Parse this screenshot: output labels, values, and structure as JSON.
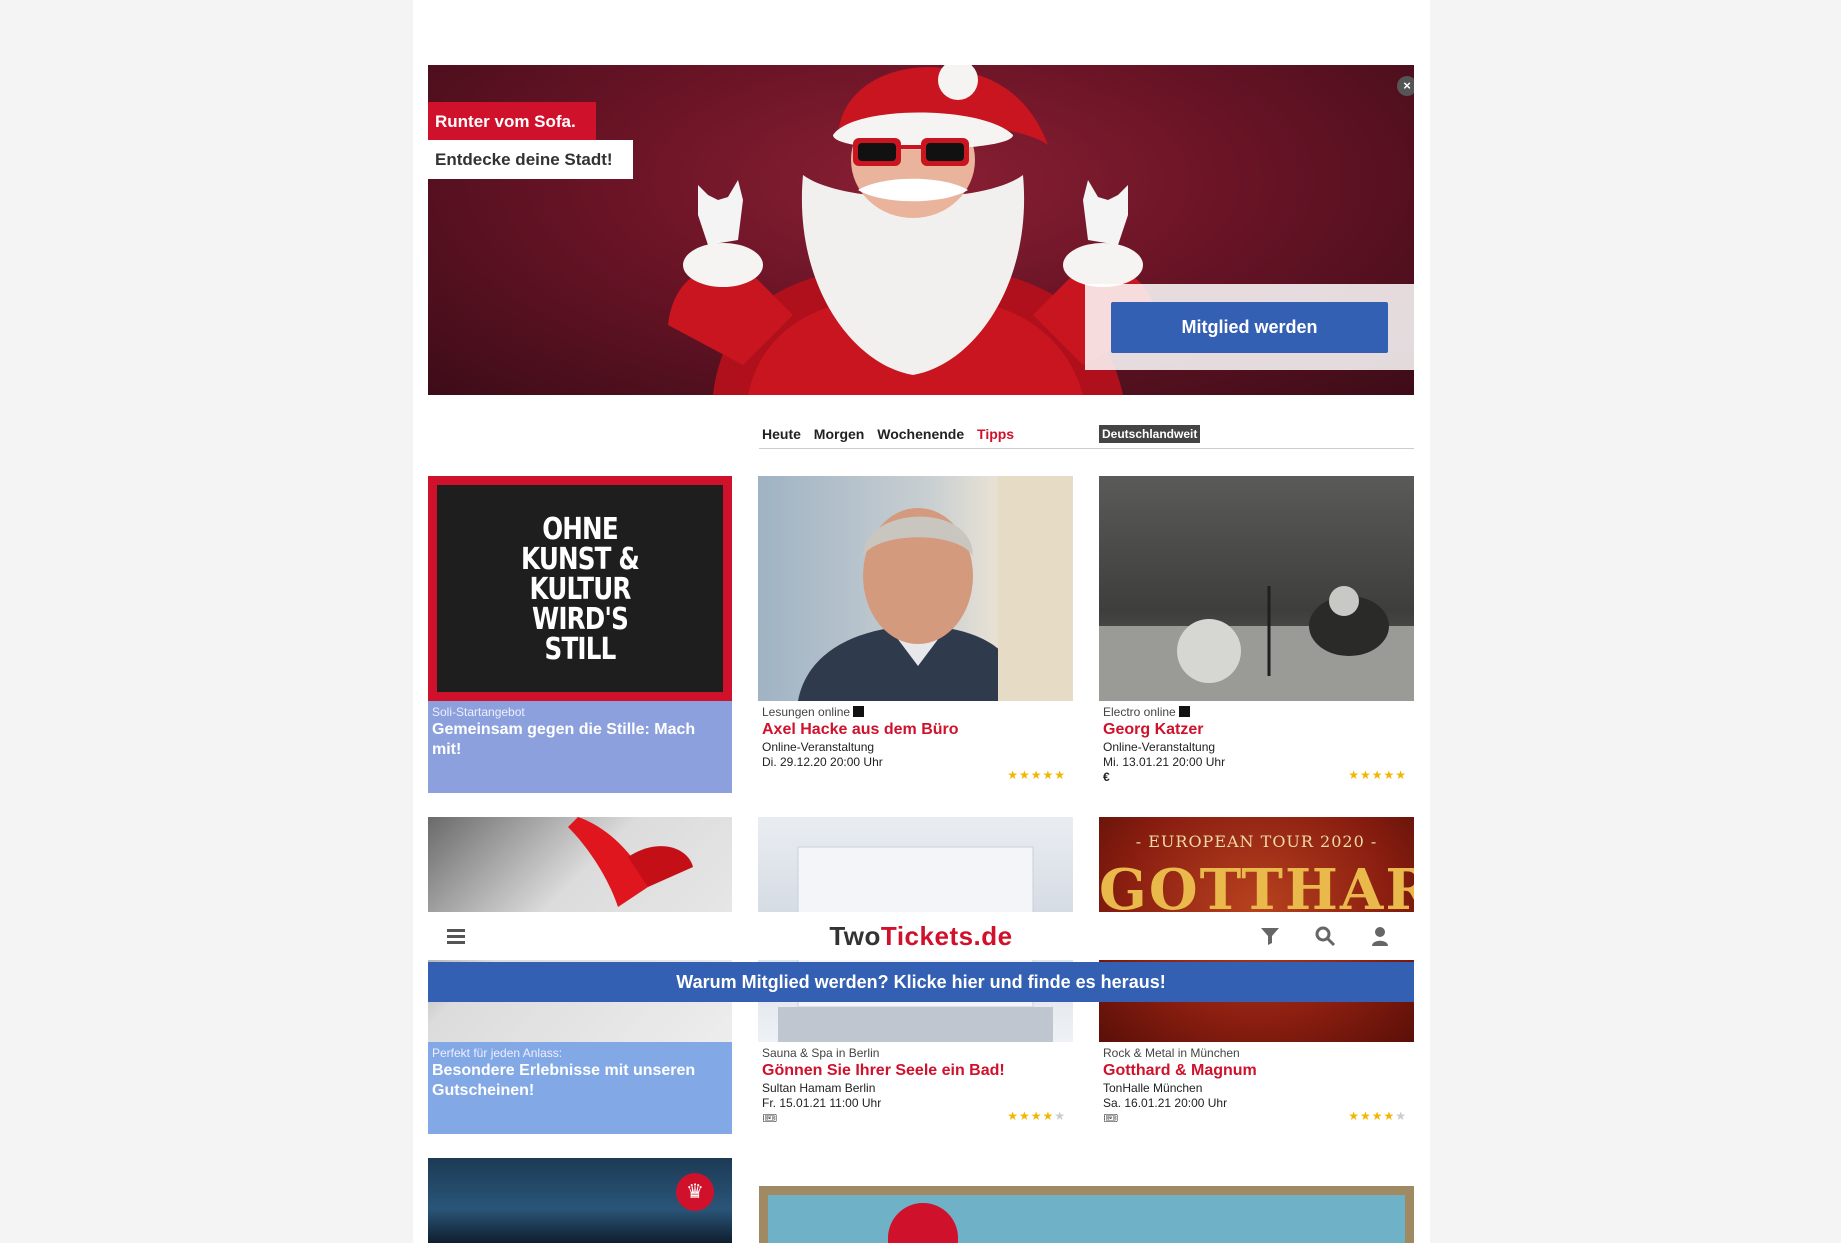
{
  "hero": {
    "tag_line1": "Runter vom Sofa.",
    "tag_line2": "Entdecke deine Stadt!",
    "close": "×",
    "cta": "Mitglied werden"
  },
  "filters": {
    "tabs": [
      "Heute",
      "Morgen",
      "Wochenende",
      "Tipps"
    ],
    "active_tab": "Tipps",
    "region": "Deutschlandweit"
  },
  "cards": [
    {
      "category": "Soli-Startangebot",
      "title": "Gemeinsam gegen die Stille: Mach mit!",
      "poster_text": [
        "OHNE",
        "KUNST &",
        "KULTUR",
        "WIRD'S",
        "STILL"
      ]
    },
    {
      "category": "Lesungen online",
      "title": "Axel Hacke aus dem Büro",
      "venue": "Online-Veranstaltung",
      "date": "Di. 29.12.20 20:00 Uhr",
      "rating": 5
    },
    {
      "category": "Electro online",
      "title": "Georg Katzer",
      "venue": "Online-Veranstaltung",
      "date": "Mi. 13.01.21 20:00 Uhr",
      "price": "€",
      "rating": 5
    },
    {
      "category": "Perfekt für jeden Anlass:",
      "title": "Besondere Erlebnisse mit unseren Gutscheinen!"
    },
    {
      "category": "Sauna & Spa in Berlin",
      "title": "Gönnen Sie Ihrer Seele ein Bad!",
      "venue": "Sultan Hamam Berlin",
      "date": "Fr. 15.01.21 11:00 Uhr",
      "rating": 4
    },
    {
      "category": "Rock & Metal in München",
      "title": "Gotthard & Magnum",
      "venue": "TonHalle München",
      "date": "Sa. 16.01.21 20:00 Uhr",
      "rating": 4,
      "poster_text": "- EUROPEAN TOUR 2020 -",
      "poster_title": "GOTTHARD"
    }
  ],
  "sticky_header": {
    "logo_part1": "Two",
    "logo_part2": "Tickets.de",
    "icons": [
      "menu-icon",
      "filter-icon",
      "search-icon",
      "user-icon"
    ]
  },
  "member_banner": "Warum Mitglied werden? Klicke hier und finde es heraus!",
  "colors": {
    "brand_red": "#d0112b",
    "brand_blue": "#3460b3",
    "star": "#f2b600"
  }
}
